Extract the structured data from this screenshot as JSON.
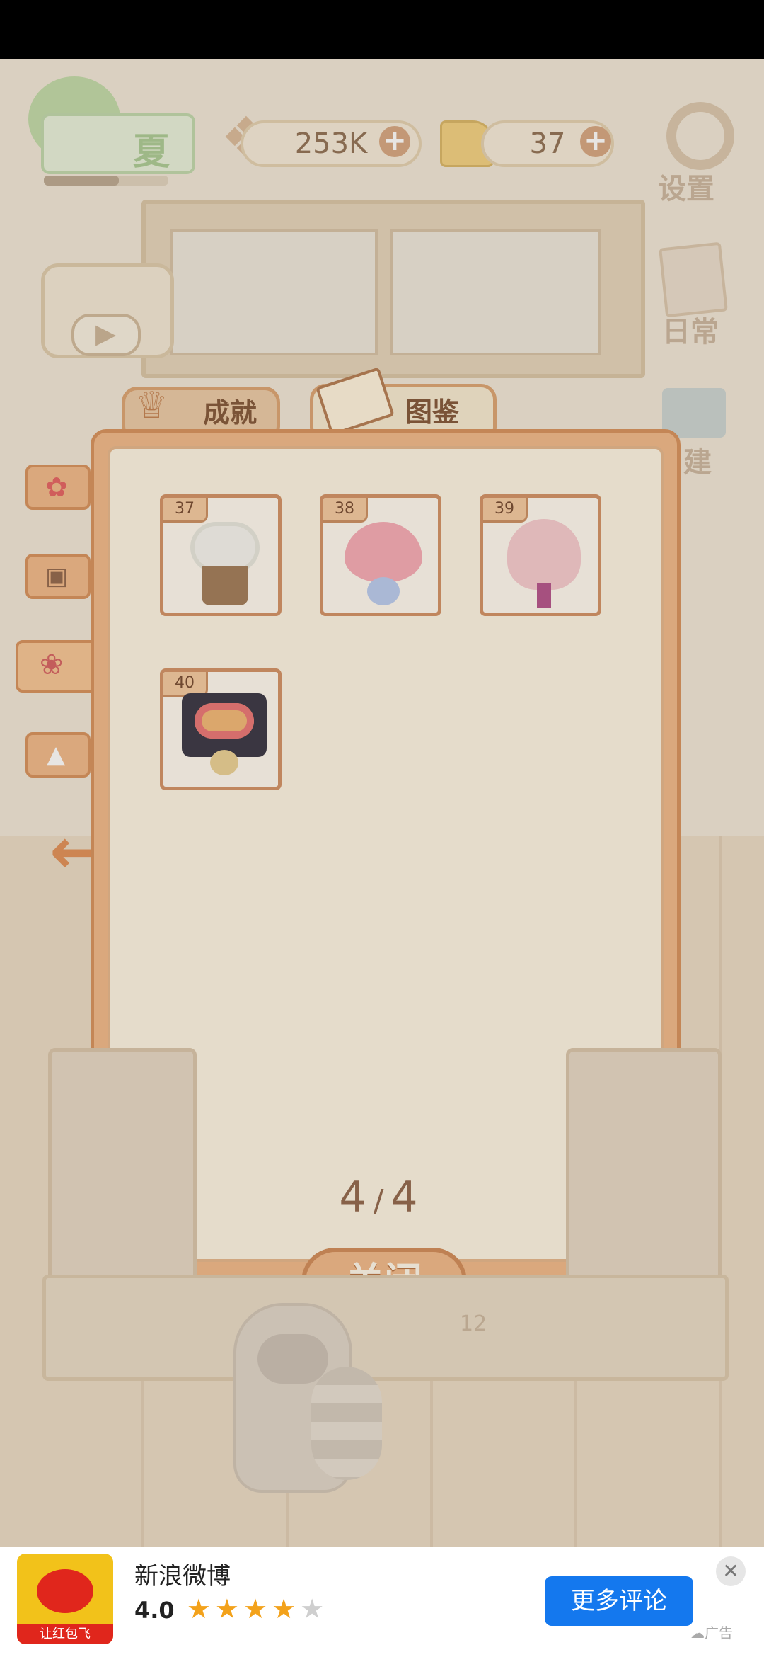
{
  "hud": {
    "level_label": "夏",
    "fish_count": "253K",
    "cheese_count": "37",
    "level_progress": 0.6
  },
  "side_menu": {
    "settings": "设置",
    "daily": "日常",
    "build": "建"
  },
  "tabs": {
    "achievement": "成就",
    "collection": "图鉴"
  },
  "collection": {
    "items": [
      {
        "num": "37",
        "name": "white-bouquet-basket"
      },
      {
        "num": "38",
        "name": "heart-bouquet"
      },
      {
        "num": "39",
        "name": "pink-bouquet"
      },
      {
        "num": "40",
        "name": "dark-wrapped-bouquet"
      }
    ],
    "page_current": "4",
    "page_total": "4",
    "page_sep": "/",
    "close_label": "关闭"
  },
  "scene": {
    "counter_number": "12"
  },
  "ad": {
    "icon_caption": "让红包飞",
    "title": "新浪微博",
    "rating": "4.0",
    "stars_filled": 4,
    "stars_total": 5,
    "cta_label": "更多评论",
    "ad_label": "广告",
    "accent": "#1478ee"
  }
}
